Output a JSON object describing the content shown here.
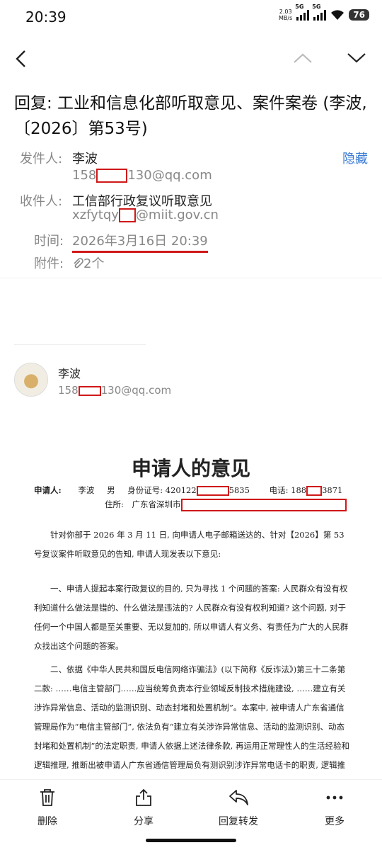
{
  "status": {
    "time": "20:39",
    "net_speed_value": "2.03",
    "net_speed_unit": "MB/s",
    "sim1": "5G",
    "sim2": "5G",
    "wifi_label": "6",
    "battery": "76"
  },
  "email": {
    "subject": "回复: 工业和信息化部听取意见、案件案卷 (李波,〔2026〕第53号)",
    "hide_label": "隐藏",
    "from_label": "发件人:",
    "from_name": "李波",
    "from_email_prefix": "158",
    "from_email_suffix": "130@qq.com",
    "to_label": "收件人:",
    "to_name": "工信部行政复议听取意见",
    "to_email_prefix": "xzfytqy",
    "to_email_suffix": "@miit.gov.cn",
    "time_label": "时间:",
    "time_value": "2026年3月16日 20:39",
    "attach_label": "附件:",
    "attach_count": "2个"
  },
  "sender_card": {
    "name": "李波",
    "email_prefix": "158",
    "email_suffix": "130@qq.com"
  },
  "document": {
    "title": "申请人的意见",
    "applicant_label": "申请人:",
    "applicant_name": "李波",
    "gender": "男",
    "id_label": "身份证号: 420122",
    "id_suffix": "5835",
    "phone_label": "电话: 188",
    "phone_suffix": "3871",
    "address_label": "住所:",
    "address_value": "广东省深圳市",
    "para0": "针对你部于 2026 年 3 月 11 日, 向申请人电子邮箱送达的、针对【2026】第 53 号复议案件听取意见的告知, 申请人现发表以下意见:",
    "para1": "一、申请人提起本案行政复议的目的, 只为寻找 1 个问题的答案: 人民群众有没有权利知道什么做法是错的、什么做法是违法的? 人民群众有没有权利知道? 这个问题, 对于任何一个中国人都是至关重要、无以复加的, 所以申请人有义务、有责任为广大的人民群众找出这个问题的答案。",
    "para2": "二、依据《中华人民共和国反电信网络诈骗法》(以下简称《反诈法》)第三十二条第二款: ……电信主管部门……应当统筹负责本行业领域反制技术措施建设, ……建立有关涉诈异常信息、活动的监测识别、动态封堵和处置机制”。本案中, 被申请人广东省通信管理局作为“电信主管部门”, 依法负有“建立有关涉诈异常信息、活动的监测识别、动态封堵和处置机制”的法定职责, 申请人依据上述法律条款, 再运用正常理性人的生活经验和逻辑推理, 推断出被申请人广东省通信管理局负有测识别涉诈异常电话卡的职责, 逻辑推理合情、合理、合法。"
  },
  "toolbar": {
    "delete": "删除",
    "share": "分享",
    "reply": "回复转发",
    "more": "更多"
  }
}
